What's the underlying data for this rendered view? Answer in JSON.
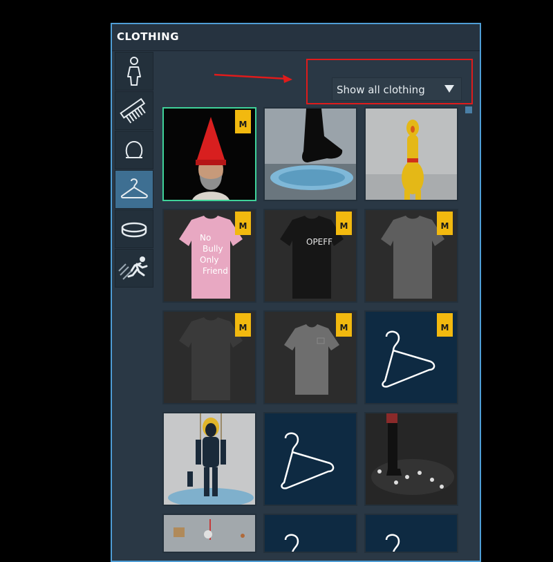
{
  "panel": {
    "title": "CLOTHING"
  },
  "tabs": [
    {
      "name": "body-tab",
      "icon": "person-icon",
      "active": false
    },
    {
      "name": "hair-tab",
      "icon": "comb-icon",
      "active": false
    },
    {
      "name": "head-tab",
      "icon": "head-outline-icon",
      "active": false
    },
    {
      "name": "clothing-tab",
      "icon": "hanger-icon",
      "active": true
    },
    {
      "name": "accessories-tab",
      "icon": "ring-icon",
      "active": false
    },
    {
      "name": "animation-tab",
      "icon": "running-person-icon",
      "active": false
    }
  ],
  "filter": {
    "selected": "Show all clothing"
  },
  "items": [
    {
      "kind": "gnome-hat-avatar",
      "badge": "M",
      "selected": true
    },
    {
      "kind": "black-boots",
      "badge": "",
      "selected": false
    },
    {
      "kind": "rubber-chicken",
      "badge": "",
      "selected": false
    },
    {
      "kind": "pink-tshirt",
      "badge": "M",
      "selected": false,
      "print": "No Bully Only Friend"
    },
    {
      "kind": "black-tshirt",
      "badge": "M",
      "selected": false,
      "print": "OPEFF"
    },
    {
      "kind": "grey-tshirt",
      "badge": "M",
      "selected": false
    },
    {
      "kind": "dark-grey-tshirt",
      "badge": "M",
      "selected": false
    },
    {
      "kind": "grey-tshirt-pocket",
      "badge": "M",
      "selected": false
    },
    {
      "kind": "hanger-placeholder",
      "badge": "M",
      "selected": false
    },
    {
      "kind": "cyber-suit-avatar",
      "badge": "",
      "selected": false
    },
    {
      "kind": "hanger-placeholder",
      "badge": "",
      "selected": false
    },
    {
      "kind": "boots-scene",
      "badge": "",
      "selected": false
    },
    {
      "kind": "scene-partial",
      "badge": "",
      "selected": false
    },
    {
      "kind": "hanger-placeholder",
      "badge": "",
      "selected": false
    },
    {
      "kind": "hanger-placeholder",
      "badge": "",
      "selected": false
    }
  ],
  "colors": {
    "accent": "#3e6f92",
    "badge": "#f2b90f",
    "selected_border": "#3fd39a",
    "annotation": "#e01b1b"
  }
}
